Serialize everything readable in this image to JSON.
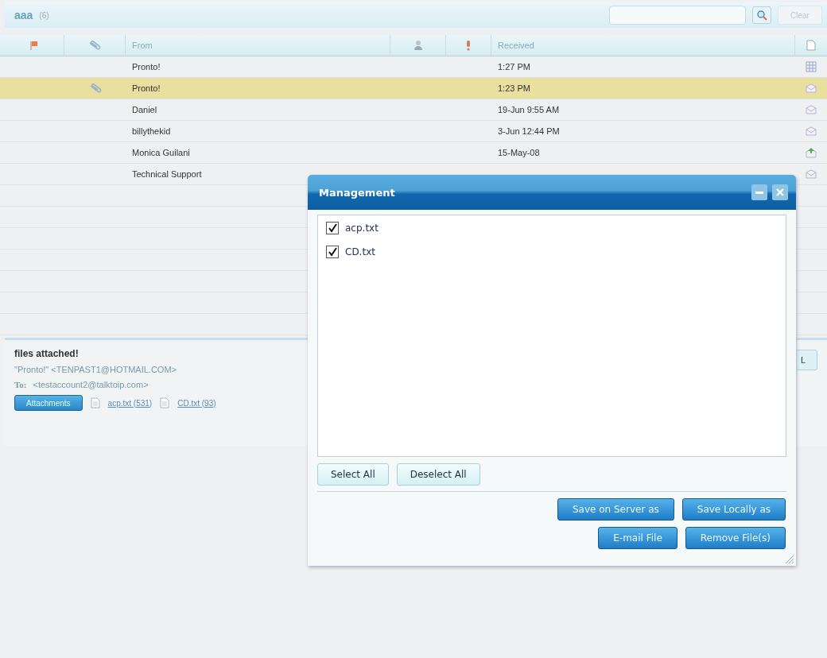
{
  "folder": {
    "name": "aaa",
    "count": "(6)"
  },
  "search": {
    "button": "Clear"
  },
  "columns": {
    "from": "From",
    "received": "Received"
  },
  "rows": [
    {
      "from": "Pronto!",
      "received": "1:27 PM",
      "attachment": false,
      "selected": false,
      "kind": "calendar"
    },
    {
      "from": "Pronto!",
      "received": "1:23 PM",
      "attachment": true,
      "selected": true,
      "kind": "mail"
    },
    {
      "from": "Daniel",
      "received": "19-Jun 9:55 AM",
      "attachment": false,
      "selected": false,
      "kind": "mail"
    },
    {
      "from": "billythekid",
      "received": "3-Jun 12:44 PM",
      "attachment": false,
      "selected": false,
      "kind": "mail"
    },
    {
      "from": "Monica Guilani",
      "received": "15-May-08",
      "attachment": false,
      "selected": false,
      "kind": "reply"
    },
    {
      "from": "Technical Support",
      "received": "",
      "attachment": false,
      "selected": false,
      "kind": "mail"
    }
  ],
  "preview": {
    "subject": "files attached!",
    "from": "\"Pronto!\" <TENPAST1@HOTMAIL.COM>",
    "to_label": "To:",
    "to": "<testaccount2@talktoip.com>",
    "attachments_button": "Attachments",
    "files": [
      "acp.txt (531)",
      "CD.txt (93)"
    ],
    "hidden_button": "L"
  },
  "dialog": {
    "title": "Management",
    "files": [
      {
        "name": "acp.txt",
        "checked": true
      },
      {
        "name": "CD.txt",
        "checked": true
      }
    ],
    "select_all": "Select All",
    "deselect_all": "Deselect All",
    "actions": [
      [
        "Save on Server as",
        "Save Locally as"
      ],
      [
        "E-mail File",
        "Remove File(s)"
      ]
    ]
  }
}
